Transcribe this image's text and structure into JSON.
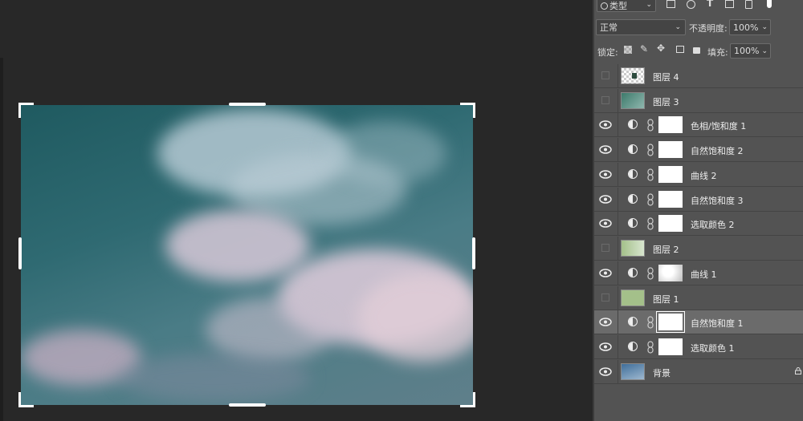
{
  "filter": {
    "kind_label": "类型"
  },
  "blend": {
    "mode": "正常",
    "opacity_label": "不透明度:",
    "opacity_value": "100%"
  },
  "lock": {
    "label": "锁定:",
    "fill_label": "填充:",
    "fill_value": "100%"
  },
  "layers": [
    {
      "name": "图层 4",
      "type": "pixel",
      "visible": false,
      "thumb": "checker-dark"
    },
    {
      "name": "图层 3",
      "type": "pixel",
      "visible": false,
      "thumb": "teal"
    },
    {
      "name": "色相/饱和度 1",
      "type": "adjustment",
      "visible": true
    },
    {
      "name": "自然饱和度 2",
      "type": "adjustment",
      "visible": true
    },
    {
      "name": "曲线 2",
      "type": "adjustment",
      "visible": true
    },
    {
      "name": "自然饱和度 3",
      "type": "adjustment",
      "visible": true
    },
    {
      "name": "选取颜色 2",
      "type": "adjustment",
      "visible": true
    },
    {
      "name": "图层 2",
      "type": "pixel",
      "visible": false,
      "thumb": "checker-green"
    },
    {
      "name": "曲线 1",
      "type": "adjustment",
      "visible": true,
      "mask": "gradient"
    },
    {
      "name": "图层 1",
      "type": "pixel",
      "visible": false,
      "thumb": "green"
    },
    {
      "name": "自然饱和度 1",
      "type": "adjustment",
      "visible": true,
      "selected": true
    },
    {
      "name": "选取颜色 1",
      "type": "adjustment",
      "visible": true
    },
    {
      "name": "背景",
      "type": "background",
      "visible": true,
      "thumb": "sky",
      "locked": true
    }
  ],
  "colors": {
    "panel": "#535353",
    "canvas_bg": "#282828",
    "selected_row": "#6b6b6b"
  }
}
